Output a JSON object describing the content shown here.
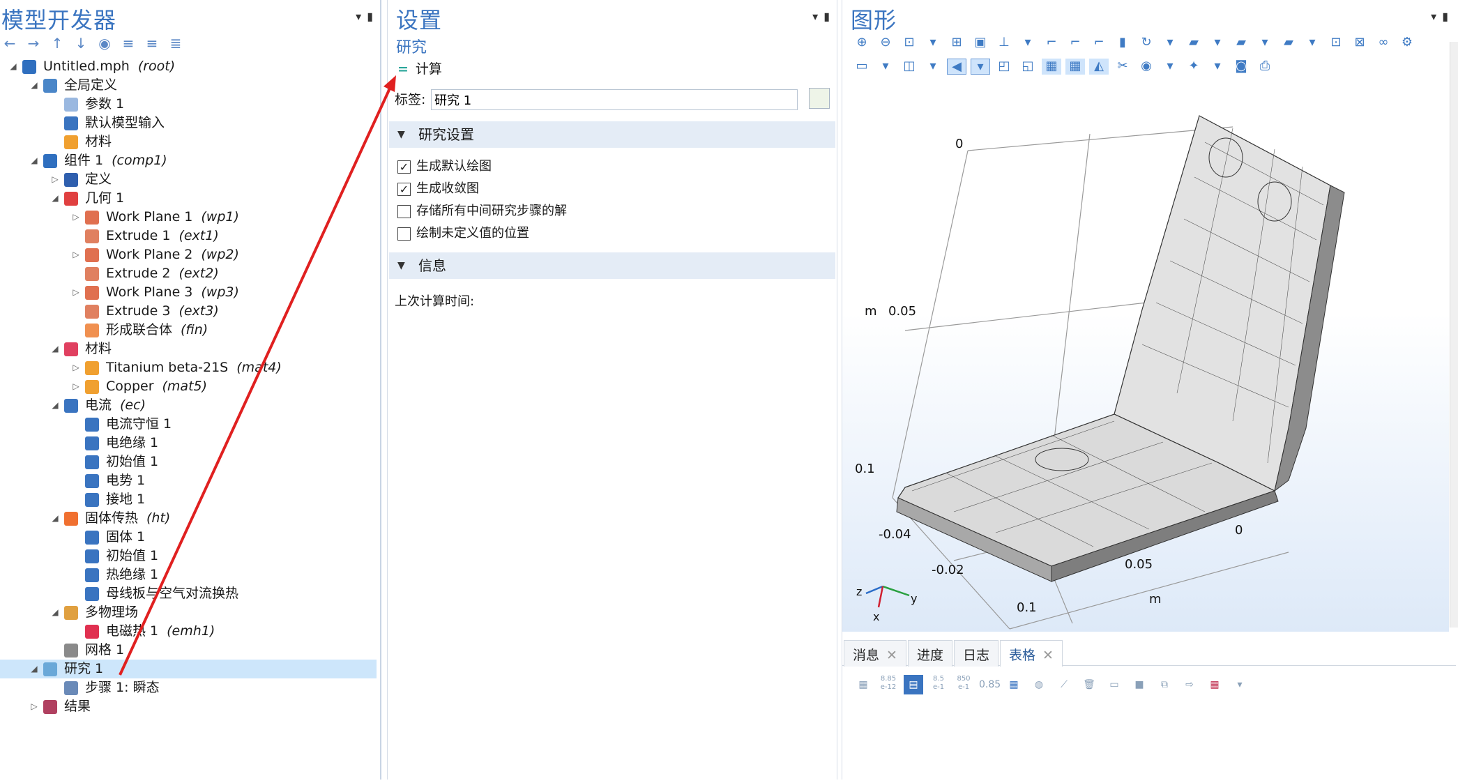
{
  "left": {
    "title": "模型开发器",
    "toolbar": [
      "←",
      "→",
      "↑",
      "↓",
      "◉",
      "≡",
      "≡",
      "≣"
    ],
    "tree": [
      {
        "label": "Untitled.mph",
        "tag": "(root)",
        "depth": 0,
        "toggle": "open",
        "icon": "mph-icon",
        "color": "#2f6fbf"
      },
      {
        "label": "全局定义",
        "tag": "",
        "depth": 1,
        "toggle": "open",
        "icon": "globe-icon",
        "color": "#4a86c8"
      },
      {
        "label": "参数 1",
        "tag": "",
        "depth": 2,
        "toggle": "",
        "icon": "parameter-icon",
        "color": "#9ab8e0"
      },
      {
        "label": "默认模型输入",
        "tag": "",
        "depth": 2,
        "toggle": "",
        "icon": "model-input-icon",
        "color": "#3a74c0"
      },
      {
        "label": "材料",
        "tag": "",
        "depth": 2,
        "toggle": "",
        "icon": "materials-icon",
        "color": "#f0a030"
      },
      {
        "label": "组件 1",
        "tag": "(comp1)",
        "depth": 1,
        "toggle": "open",
        "icon": "component-icon",
        "color": "#2f6fbf"
      },
      {
        "label": "定义",
        "tag": "",
        "depth": 2,
        "toggle": "closed",
        "icon": "definitions-icon",
        "color": "#2f5fae"
      },
      {
        "label": "几何 1",
        "tag": "",
        "depth": 2,
        "toggle": "open",
        "icon": "geometry-icon",
        "color": "#e04040"
      },
      {
        "label": "Work Plane 1",
        "tag": "(wp1)",
        "depth": 3,
        "toggle": "closed",
        "icon": "work-plane-icon",
        "color": "#e07050"
      },
      {
        "label": "Extrude 1",
        "tag": "(ext1)",
        "depth": 3,
        "toggle": "",
        "icon": "extrude-icon",
        "color": "#e08060"
      },
      {
        "label": "Work Plane 2",
        "tag": "(wp2)",
        "depth": 3,
        "toggle": "closed",
        "icon": "work-plane-icon",
        "color": "#e07050"
      },
      {
        "label": "Extrude 2",
        "tag": "(ext2)",
        "depth": 3,
        "toggle": "",
        "icon": "extrude-icon",
        "color": "#e08060"
      },
      {
        "label": "Work Plane 3",
        "tag": "(wp3)",
        "depth": 3,
        "toggle": "closed",
        "icon": "work-plane-icon",
        "color": "#e07050"
      },
      {
        "label": "Extrude 3",
        "tag": "(ext3)",
        "depth": 3,
        "toggle": "",
        "icon": "extrude-icon",
        "color": "#e08060"
      },
      {
        "label": "形成联合体",
        "tag": "(fin)",
        "depth": 3,
        "toggle": "",
        "icon": "form-union-icon",
        "color": "#f09050"
      },
      {
        "label": "材料",
        "tag": "",
        "depth": 2,
        "toggle": "open",
        "icon": "materials-icon",
        "color": "#e04060"
      },
      {
        "label": "Titanium beta-21S",
        "tag": "(mat4)",
        "depth": 3,
        "toggle": "closed",
        "icon": "material-icon",
        "color": "#f0a030"
      },
      {
        "label": "Copper",
        "tag": "(mat5)",
        "depth": 3,
        "toggle": "closed",
        "icon": "material-icon",
        "color": "#f0a030"
      },
      {
        "label": "电流",
        "tag": "(ec)",
        "depth": 2,
        "toggle": "open",
        "icon": "electric-currents-icon",
        "color": "#3a74c0"
      },
      {
        "label": "电流守恒 1",
        "tag": "",
        "depth": 3,
        "toggle": "",
        "icon": "physics-node-icon",
        "color": "#3a74c0"
      },
      {
        "label": "电绝缘 1",
        "tag": "",
        "depth": 3,
        "toggle": "",
        "icon": "physics-node-icon",
        "color": "#3a74c0"
      },
      {
        "label": "初始值 1",
        "tag": "",
        "depth": 3,
        "toggle": "",
        "icon": "physics-node-icon",
        "color": "#3a74c0"
      },
      {
        "label": "电势 1",
        "tag": "",
        "depth": 3,
        "toggle": "",
        "icon": "physics-node-icon",
        "color": "#3a74c0"
      },
      {
        "label": "接地 1",
        "tag": "",
        "depth": 3,
        "toggle": "",
        "icon": "physics-node-icon",
        "color": "#3a74c0"
      },
      {
        "label": "固体传热",
        "tag": "(ht)",
        "depth": 2,
        "toggle": "open",
        "icon": "heat-transfer-icon",
        "color": "#f07030"
      },
      {
        "label": "固体 1",
        "tag": "",
        "depth": 3,
        "toggle": "",
        "icon": "physics-node-icon",
        "color": "#3a74c0"
      },
      {
        "label": "初始值 1",
        "tag": "",
        "depth": 3,
        "toggle": "",
        "icon": "physics-node-icon",
        "color": "#3a74c0"
      },
      {
        "label": "热绝缘 1",
        "tag": "",
        "depth": 3,
        "toggle": "",
        "icon": "physics-node-icon",
        "color": "#3a74c0"
      },
      {
        "label": "母线板与空气对流换热",
        "tag": "",
        "depth": 3,
        "toggle": "",
        "icon": "physics-node-icon",
        "color": "#3a74c0"
      },
      {
        "label": "多物理场",
        "tag": "",
        "depth": 2,
        "toggle": "open",
        "icon": "multiphysics-icon",
        "color": "#e0a040"
      },
      {
        "label": "电磁热 1",
        "tag": "(emh1)",
        "depth": 3,
        "toggle": "",
        "icon": "electromagnetic-heating-icon",
        "color": "#e03050"
      },
      {
        "label": "网格 1",
        "tag": "",
        "depth": 2,
        "toggle": "",
        "icon": "mesh-icon",
        "color": "#8a8a8a"
      },
      {
        "label": "研究 1",
        "tag": "",
        "depth": 1,
        "toggle": "open",
        "icon": "study-icon",
        "color": "#6aa8d8",
        "selected": true
      },
      {
        "label": "步骤 1: 瞬态",
        "tag": "",
        "depth": 2,
        "toggle": "",
        "icon": "time-dependent-icon",
        "color": "#6a8ab8"
      },
      {
        "label": "结果",
        "tag": "",
        "depth": 1,
        "toggle": "closed",
        "icon": "results-icon",
        "color": "#b04060"
      }
    ]
  },
  "mid": {
    "title": "设置",
    "subtitle": "研究",
    "compute": "计算",
    "label_caption": "标签:",
    "label_value": "研究 1",
    "section1": "研究设置",
    "checks": [
      {
        "label": "生成默认绘图",
        "checked": "✓"
      },
      {
        "label": "生成收敛图",
        "checked": "✓"
      },
      {
        "label": "存储所有中间研究步骤的解",
        "checked": ""
      },
      {
        "label": "绘制未定义值的位置",
        "checked": ""
      }
    ],
    "section2": "信息",
    "info_label": "上次计算时间:"
  },
  "right": {
    "title": "图形",
    "axis_labels": {
      "m1": "m",
      "v005": "0.05",
      "v0top": "0",
      "v01": "0.1",
      "vm004": "-0.04",
      "vm002": "-0.02",
      "x0": "0",
      "x005": "0.05",
      "x01": "0.1",
      "m2": "m"
    },
    "triad": {
      "z": "z",
      "y": "y",
      "x": "x"
    },
    "tabs": [
      "消息",
      "进度",
      "日志",
      "表格"
    ],
    "table_tool_labels": [
      "8.85\ne-12",
      "8.5\ne-1",
      "850\ne-1",
      "0.85"
    ]
  },
  "colors": {
    "accent": "#3a74c0",
    "selected": "#cde6fb",
    "arrow": "#e02020",
    "section": "#e4ecf6"
  }
}
